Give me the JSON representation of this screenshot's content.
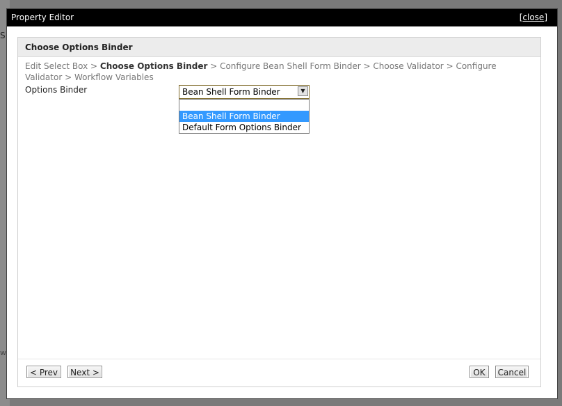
{
  "window": {
    "title": "Property Editor",
    "close_bracket_open": "[",
    "close_label": "close",
    "close_bracket_close": "]"
  },
  "panel": {
    "title": "Choose Options Binder"
  },
  "breadcrumb": {
    "steps": [
      {
        "label": "Edit Select Box",
        "sep": " > "
      },
      {
        "label": "Choose Options Binder",
        "sep": " > "
      },
      {
        "label": "Configure Bean Shell Form Binder",
        "sep": " > "
      },
      {
        "label": "Choose Validator",
        "sep": " > "
      },
      {
        "label": "Configure Validator",
        "sep": " > "
      },
      {
        "label": "Workflow Variables",
        "sep": ""
      }
    ]
  },
  "form": {
    "options_binder_label": "Options Binder",
    "options_binder_value": "Bean Shell Form Binder",
    "arrow_glyph": "▼",
    "options": [
      "",
      "Bean Shell Form Binder",
      "Default Form Options Binder"
    ]
  },
  "buttons": {
    "prev": "< Prev",
    "next": "Next >",
    "ok": "OK",
    "cancel": "Cancel"
  },
  "background": {
    "char1": "S",
    "char2": "w"
  },
  "colors": {
    "titlebar": "#000000",
    "selected_option": "#3399ff",
    "header": "#ececec"
  }
}
